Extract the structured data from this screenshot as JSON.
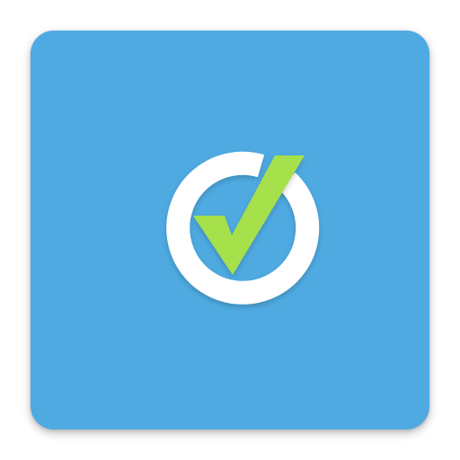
{
  "icon": {
    "name": "checkmark-circle-icon",
    "tile_color": "#4eaae1",
    "ring_color": "#ffffff",
    "check_color": "#a6e04c"
  }
}
